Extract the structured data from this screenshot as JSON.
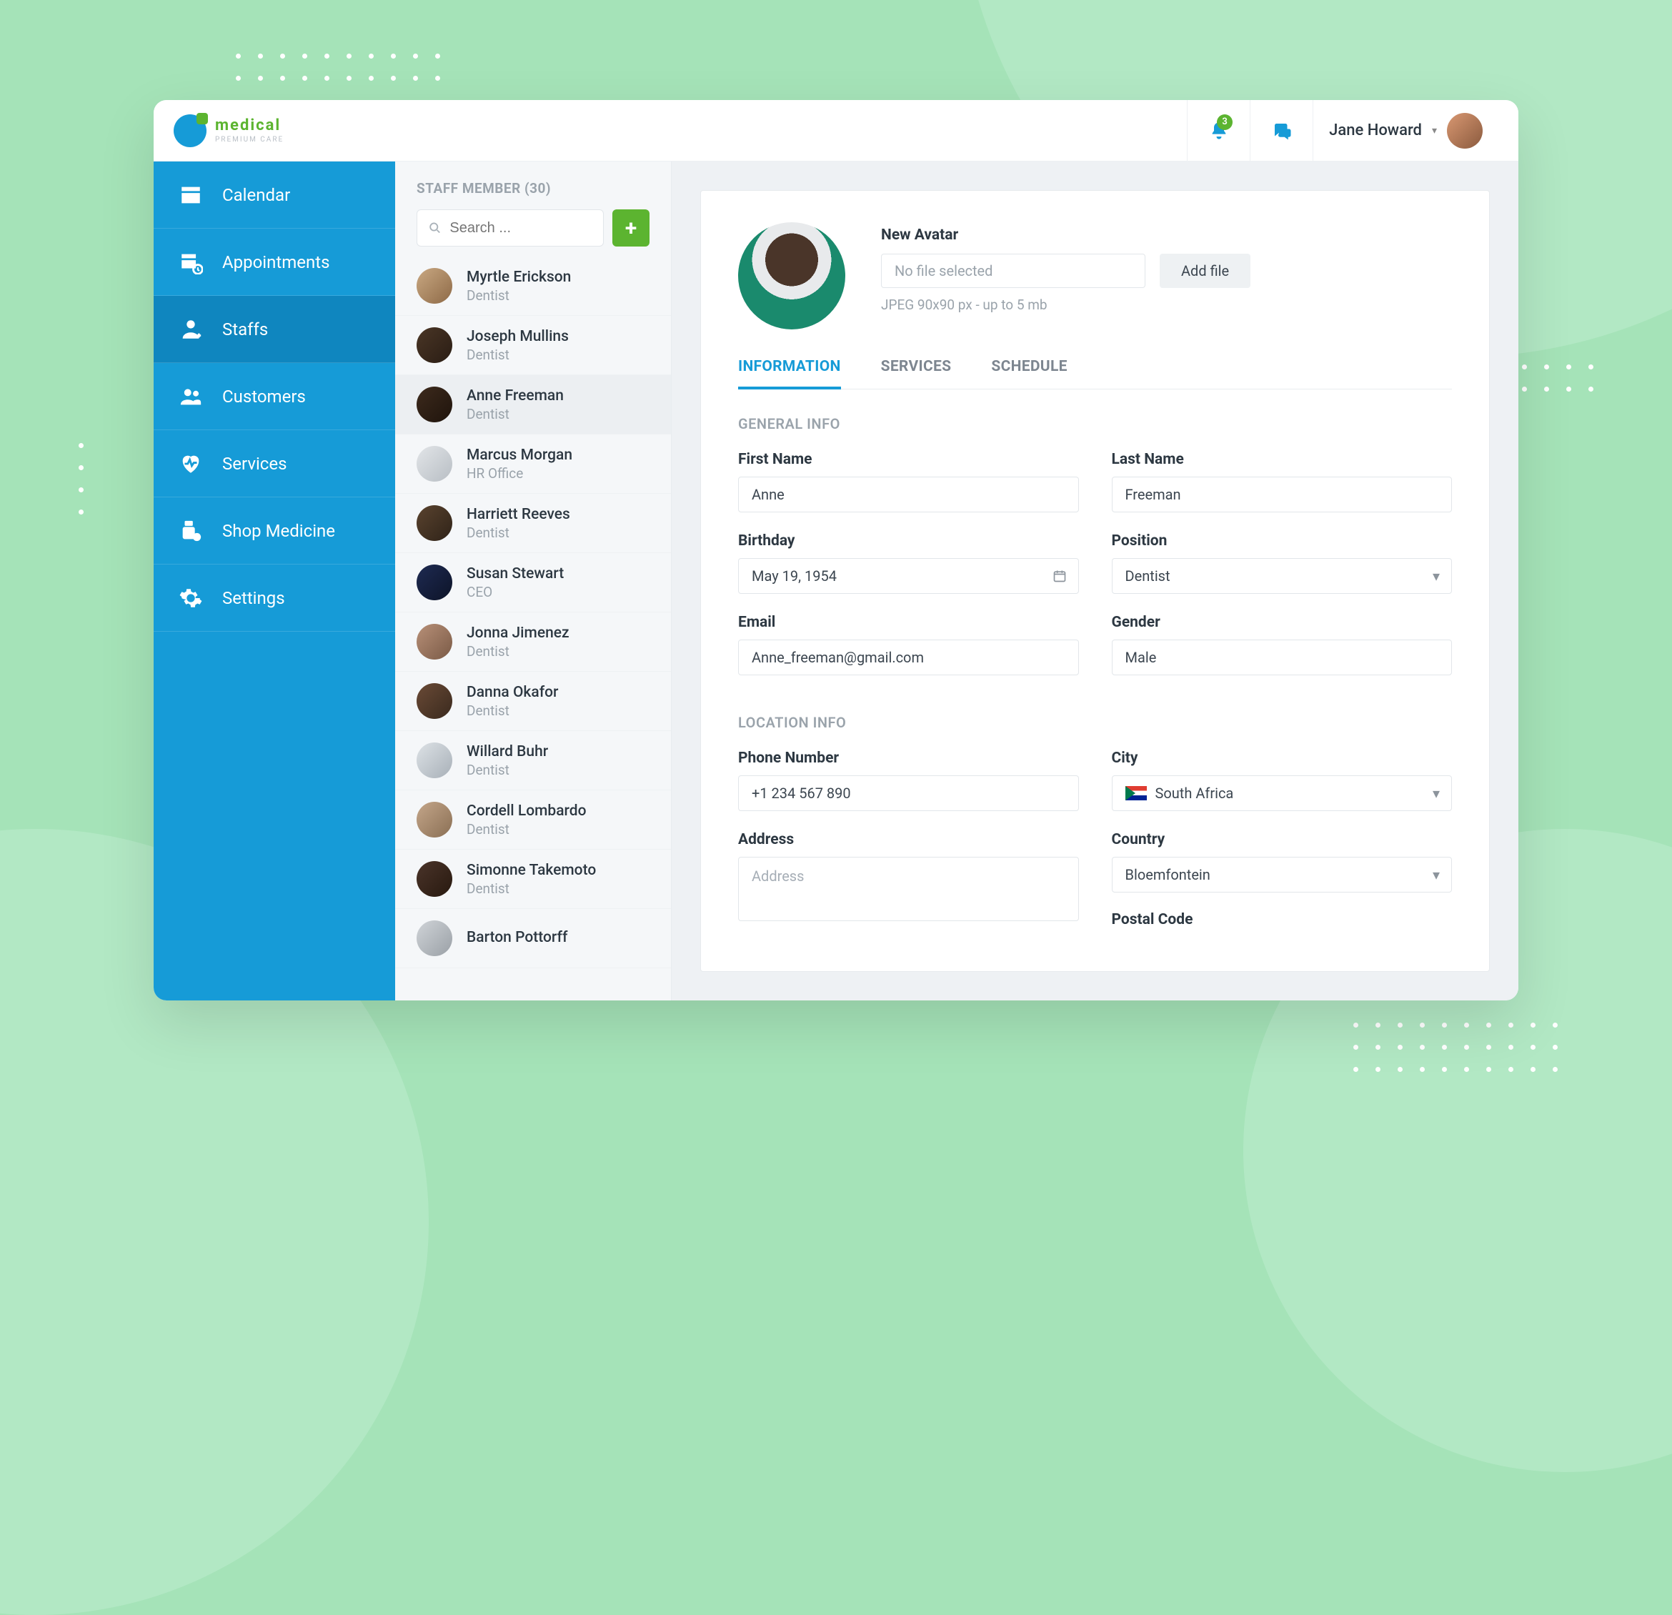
{
  "brand": {
    "name": "medical",
    "tagline": "PREMIUM CARE"
  },
  "topbar": {
    "notification_count": "3",
    "user_name": "Jane Howard"
  },
  "sidebar": {
    "items": [
      {
        "label": "Calendar"
      },
      {
        "label": "Appointments"
      },
      {
        "label": "Staffs"
      },
      {
        "label": "Customers"
      },
      {
        "label": "Services"
      },
      {
        "label": "Shop Medicine"
      },
      {
        "label": "Settings"
      }
    ]
  },
  "staff_panel": {
    "title": "STAFF MEMBER (30)",
    "search_placeholder": "Search ...",
    "members": [
      {
        "name": "Myrtle Erickson",
        "role": "Dentist",
        "bg": "linear-gradient(135deg,#c9a882,#8e6a47)"
      },
      {
        "name": "Joseph Mullins",
        "role": "Dentist",
        "bg": "linear-gradient(135deg,#4a3626,#2a1d14)"
      },
      {
        "name": "Anne Freeman",
        "role": "Dentist",
        "bg": "linear-gradient(135deg,#3d2a1d,#1f140c)"
      },
      {
        "name": "Marcus Morgan",
        "role": "HR Office",
        "bg": "linear-gradient(135deg,#e2e5e8,#b8bec4)"
      },
      {
        "name": "Harriett Reeves",
        "role": "Dentist",
        "bg": "linear-gradient(135deg,#5a432f,#2f2318)"
      },
      {
        "name": "Susan Stewart",
        "role": "CEO",
        "bg": "linear-gradient(135deg,#1e2a52,#0d1428)"
      },
      {
        "name": "Jonna Jimenez",
        "role": "Dentist",
        "bg": "linear-gradient(135deg,#b89078,#7a5a46)"
      },
      {
        "name": "Danna Okafor",
        "role": "Dentist",
        "bg": "linear-gradient(135deg,#6a4a36,#3a2a1e)"
      },
      {
        "name": "Willard Buhr",
        "role": "Dentist",
        "bg": "linear-gradient(135deg,#dde2e6,#a8b0b8)"
      },
      {
        "name": "Cordell Lombardo",
        "role": "Dentist",
        "bg": "linear-gradient(135deg,#c4a68a,#8a6f54)"
      },
      {
        "name": "Simonne Takemoto",
        "role": "Dentist",
        "bg": "linear-gradient(135deg,#4a342a,#28190f)"
      },
      {
        "name": "Barton Pottorff",
        "role": "",
        "bg": "linear-gradient(135deg,#d0d4d8,#9aa0a6)"
      }
    ],
    "selected_index": 2
  },
  "profile": {
    "avatar_label": "New Avatar",
    "file_placeholder": "No file selected",
    "add_file": "Add file",
    "hint": "JPEG 90x90 px - up to 5 mb",
    "tabs": [
      "INFORMATION",
      "SERVICES",
      "SCHEDULE"
    ],
    "sections": {
      "general": {
        "title": "GENERAL INFO",
        "first_name_label": "First Name",
        "first_name": "Anne",
        "last_name_label": "Last Name",
        "last_name": "Freeman",
        "birthday_label": "Birthday",
        "birthday": "May 19, 1954",
        "position_label": "Position",
        "position": "Dentist",
        "email_label": "Email",
        "email": "Anne_freeman@gmail.com",
        "gender_label": "Gender",
        "gender": "Male"
      },
      "location": {
        "title": "LOCATION INFO",
        "phone_label": "Phone Number",
        "phone": "+1 234 567 890",
        "city_label": "City",
        "city": "South Africa",
        "address_label": "Address",
        "address_placeholder": "Address",
        "country_label": "Country",
        "country": "Bloemfontein",
        "postal_label": "Postal Code"
      }
    }
  }
}
